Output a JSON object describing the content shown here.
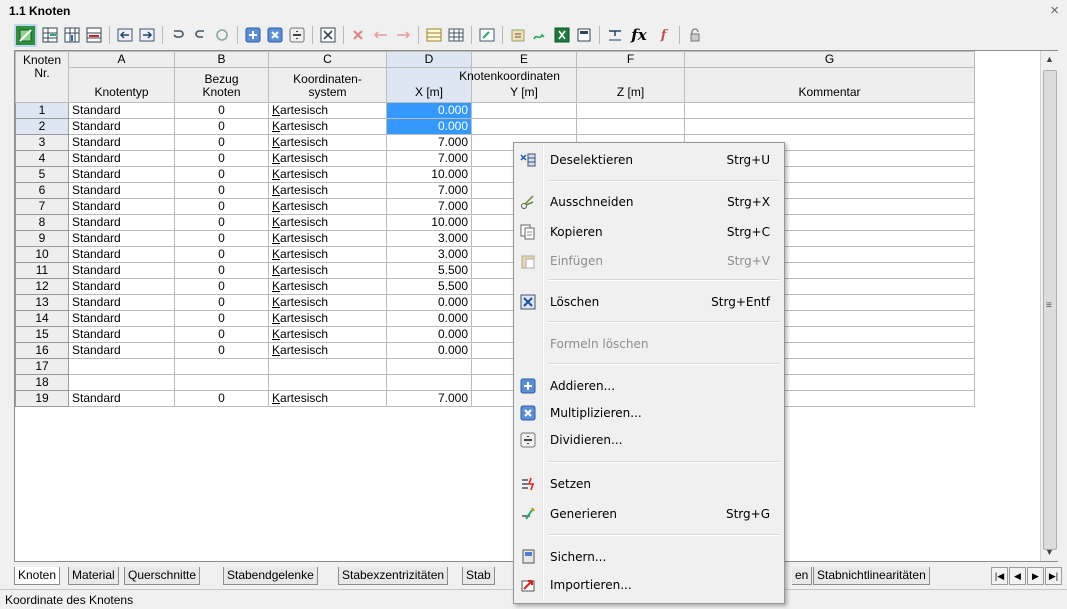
{
  "window": {
    "title": "1.1 Knoten",
    "close": "×"
  },
  "columns": {
    "letters": [
      "A",
      "B",
      "C",
      "D",
      "E",
      "F",
      "G"
    ],
    "row_header_line1": "Knoten",
    "row_header_line2": "Nr.",
    "header2": [
      "Knotentyp",
      "Bezug\nKnoten",
      "Koordinaten-\nsystem",
      "X [m]",
      "Y [m]",
      "Z [m]",
      "Kommentar"
    ],
    "group": "Knotenkoordinaten"
  },
  "rows": [
    {
      "nr": "1",
      "typ": "Standard",
      "bezug": "0",
      "ks": "Kartesisch",
      "x": "0.000"
    },
    {
      "nr": "2",
      "typ": "Standard",
      "bezug": "0",
      "ks": "Kartesisch",
      "x": "0.000"
    },
    {
      "nr": "3",
      "typ": "Standard",
      "bezug": "0",
      "ks": "Kartesisch",
      "x": "7.000"
    },
    {
      "nr": "4",
      "typ": "Standard",
      "bezug": "0",
      "ks": "Kartesisch",
      "x": "7.000"
    },
    {
      "nr": "5",
      "typ": "Standard",
      "bezug": "0",
      "ks": "Kartesisch",
      "x": "10.000"
    },
    {
      "nr": "6",
      "typ": "Standard",
      "bezug": "0",
      "ks": "Kartesisch",
      "x": "7.000"
    },
    {
      "nr": "7",
      "typ": "Standard",
      "bezug": "0",
      "ks": "Kartesisch",
      "x": "7.000"
    },
    {
      "nr": "8",
      "typ": "Standard",
      "bezug": "0",
      "ks": "Kartesisch",
      "x": "10.000"
    },
    {
      "nr": "9",
      "typ": "Standard",
      "bezug": "0",
      "ks": "Kartesisch",
      "x": "3.000"
    },
    {
      "nr": "10",
      "typ": "Standard",
      "bezug": "0",
      "ks": "Kartesisch",
      "x": "3.000"
    },
    {
      "nr": "11",
      "typ": "Standard",
      "bezug": "0",
      "ks": "Kartesisch",
      "x": "5.500"
    },
    {
      "nr": "12",
      "typ": "Standard",
      "bezug": "0",
      "ks": "Kartesisch",
      "x": "5.500"
    },
    {
      "nr": "13",
      "typ": "Standard",
      "bezug": "0",
      "ks": "Kartesisch",
      "x": "0.000"
    },
    {
      "nr": "14",
      "typ": "Standard",
      "bezug": "0",
      "ks": "Kartesisch",
      "x": "0.000"
    },
    {
      "nr": "15",
      "typ": "Standard",
      "bezug": "0",
      "ks": "Kartesisch",
      "x": "0.000"
    },
    {
      "nr": "16",
      "typ": "Standard",
      "bezug": "0",
      "ks": "Kartesisch",
      "x": "0.000"
    },
    {
      "nr": "17",
      "typ": "",
      "bezug": "",
      "ks": "",
      "x": ""
    },
    {
      "nr": "18",
      "typ": "",
      "bezug": "",
      "ks": "",
      "x": ""
    },
    {
      "nr": "19",
      "typ": "Standard",
      "bezug": "0",
      "ks": "Kartesisch",
      "x": "7.000"
    }
  ],
  "selection_color": "#3399ff",
  "context_menu": {
    "deselect": {
      "label": "Deselektieren",
      "key": "Strg+U"
    },
    "cut": {
      "label": "Ausschneiden",
      "key": "Strg+X"
    },
    "copy": {
      "label": "Kopieren",
      "key": "Strg+C"
    },
    "paste": {
      "label": "Einfügen",
      "key": "Strg+V"
    },
    "delete": {
      "label": "Löschen",
      "key": "Strg+Entf"
    },
    "clear_formulas": {
      "label": "Formeln löschen"
    },
    "add": {
      "label": "Addieren..."
    },
    "multiply": {
      "label": "Multiplizieren..."
    },
    "divide": {
      "label": "Dividieren..."
    },
    "set": {
      "label": "Setzen"
    },
    "generate": {
      "label": "Generieren",
      "key": "Strg+G"
    },
    "save": {
      "label": "Sichern..."
    },
    "import": {
      "label": "Importieren..."
    }
  },
  "sheets": {
    "knoten": "Knoten",
    "material": "Material",
    "querschnitte": "Querschnitte",
    "stabendgelenke": "Stabendgelenke",
    "stabexzentrizitaeten": "Stabexzentrizitäten",
    "stab_partial": "Stab",
    "en_partial": "en",
    "stabnichtlinearitaeten": "Stabnichtlinearitäten"
  },
  "status": "Koordinate des Knotens"
}
